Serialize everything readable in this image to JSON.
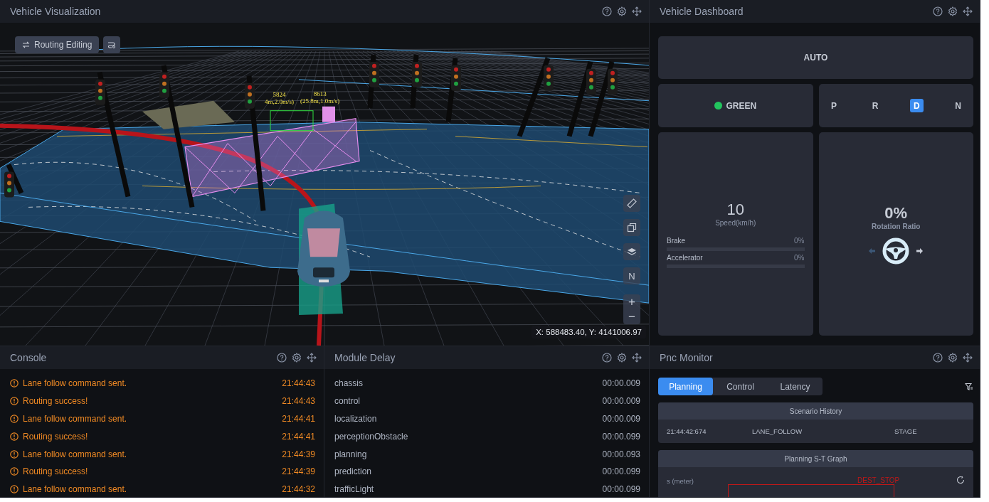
{
  "visualization": {
    "title": "Vehicle Visualization",
    "routing_button": "Routing Editing",
    "obstacle_labels": [
      {
        "id": "5824",
        "info": "4m,2.0m/s)"
      },
      {
        "id": "8613",
        "info": "(25.8m,1.0m/s)"
      }
    ],
    "map_tools": [
      {
        "kind": "ruler"
      },
      {
        "kind": "copy"
      },
      {
        "kind": "layers"
      },
      {
        "kind": "compass",
        "label": "N"
      }
    ],
    "zoom_in": "+",
    "zoom_out": "−",
    "coordinates": "X: 588483.40, Y: 4141006.97"
  },
  "dashboard": {
    "title": "Vehicle Dashboard",
    "mode": "AUTO",
    "signal": {
      "label": "GREEN",
      "color": "#22c55e"
    },
    "gears": [
      {
        "label": "P",
        "selected": false
      },
      {
        "label": "R",
        "selected": false
      },
      {
        "label": "D",
        "selected": true
      },
      {
        "label": "N",
        "selected": false
      }
    ],
    "speed": {
      "value": "10",
      "label": "Speed(km/h)"
    },
    "meters": [
      {
        "label": "Brake",
        "reading": "0%",
        "level": 0
      },
      {
        "label": "Accelerator",
        "reading": "0%",
        "level": 0
      }
    ],
    "rotation": {
      "value": "0%",
      "label": "Rotation Ratio"
    }
  },
  "console": {
    "title": "Console",
    "messages": [
      {
        "text": "Lane follow command sent.",
        "time": "21:44:43"
      },
      {
        "text": "Routing success!",
        "time": "21:44:43"
      },
      {
        "text": "Lane follow command sent.",
        "time": "21:44:41"
      },
      {
        "text": "Routing success!",
        "time": "21:44:41"
      },
      {
        "text": "Lane follow command sent.",
        "time": "21:44:39"
      },
      {
        "text": "Routing success!",
        "time": "21:44:39"
      },
      {
        "text": "Lane follow command sent.",
        "time": "21:44:32"
      }
    ]
  },
  "module_delay": {
    "title": "Module Delay",
    "rows": [
      {
        "name": "chassis",
        "delay": "00:00.009"
      },
      {
        "name": "control",
        "delay": "00:00.009"
      },
      {
        "name": "localization",
        "delay": "00:00.009"
      },
      {
        "name": "perceptionObstacle",
        "delay": "00:00.099"
      },
      {
        "name": "planning",
        "delay": "00:00.093"
      },
      {
        "name": "prediction",
        "delay": "00:00.099"
      },
      {
        "name": "trafficLight",
        "delay": "00:00.099"
      }
    ]
  },
  "pnc_monitor": {
    "title": "Pnc Monitor",
    "tabs": [
      {
        "label": "Planning",
        "selected": true
      },
      {
        "label": "Control",
        "selected": false
      },
      {
        "label": "Latency",
        "selected": false
      }
    ],
    "scenario_history": {
      "title": "Scenario History",
      "rows": [
        {
          "time": "21:44:42:674",
          "scenario": "LANE_FOLLOW",
          "stage": "STAGE"
        }
      ]
    },
    "st_graph": {
      "title": "Planning S-T Graph",
      "ylabel": "s (meter)",
      "marker": "DEST_STOP"
    }
  }
}
